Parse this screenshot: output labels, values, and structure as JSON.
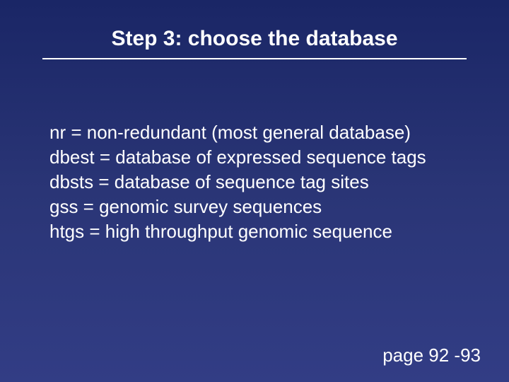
{
  "slide": {
    "title": "Step 3: choose the database",
    "lines": [
      "nr = non-redundant (most general database)",
      "dbest = database of expressed sequence tags",
      "dbsts = database of sequence tag sites",
      "gss = genomic survey sequences",
      "htgs = high throughput genomic sequence"
    ],
    "footer": "page 92 -93"
  }
}
